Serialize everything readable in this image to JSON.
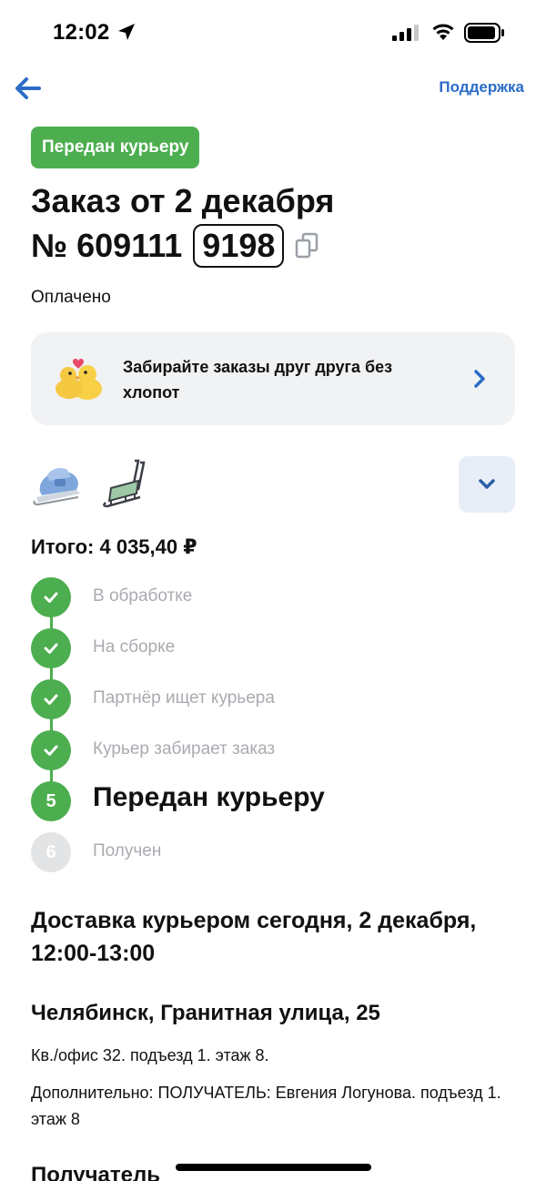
{
  "status_bar": {
    "time": "12:02",
    "icons": [
      "location-arrow-icon",
      "cellular-signal-icon",
      "wifi-icon",
      "battery-icon"
    ]
  },
  "header": {
    "back_icon": "arrow-left-icon",
    "support_label": "Поддержка"
  },
  "order": {
    "status_badge": "Передан курьеру",
    "title": "Заказ от 2 декабря",
    "number_prefix": "№ 609111",
    "number_suffix": "9198",
    "payment_status": "Оплачено"
  },
  "promo": {
    "text": "Забирайте заказы друг друга без хлопот",
    "icon": "ducks-emoji-icon"
  },
  "products": [
    {
      "name": "sled-with-seat-thumbnail"
    },
    {
      "name": "sled-frame-thumbnail"
    }
  ],
  "total": "Итого: 4 035,40 ₽",
  "steps": [
    {
      "label": "В обработке",
      "state": "done",
      "mark": ""
    },
    {
      "label": "На сборке",
      "state": "done",
      "mark": ""
    },
    {
      "label": "Партнёр ищет курьера",
      "state": "done",
      "mark": ""
    },
    {
      "label": "Курьер забирает заказ",
      "state": "done",
      "mark": ""
    },
    {
      "label": "Передан курьеру",
      "state": "current",
      "mark": "5"
    },
    {
      "label": "Получен",
      "state": "future",
      "mark": "6"
    }
  ],
  "delivery": {
    "title": "Доставка курьером сегодня, 2 декабря, 12:00-13:00",
    "address": "Челябинск, Гранитная улица, 25",
    "details": "Кв./офис 32. подъезд 1. этаж 8.",
    "extra": "Дополнительно: ПОЛУЧАТЕЛЬ: Евгения Логунова. подъезд 1. этаж 8"
  },
  "recipient_heading": "Получатель",
  "colors": {
    "accent_green": "#4cae4f",
    "link_blue": "#2b6cc8",
    "muted_text": "#a8abb0",
    "card_bg": "#f1f2f4"
  }
}
